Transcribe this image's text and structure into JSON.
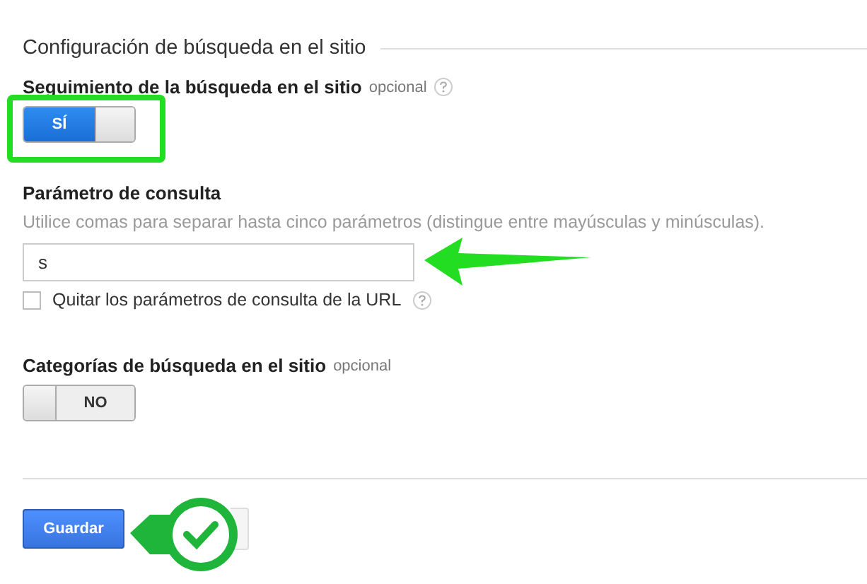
{
  "section_title": "Configuración de búsqueda en el sitio",
  "site_search_tracking": {
    "label": "Seguimiento de la búsqueda en el sitio",
    "optional": "opcional",
    "toggle": {
      "label": "SÍ",
      "on": true
    }
  },
  "query_parameter": {
    "label": "Parámetro de consulta",
    "hint": "Utilice comas para separar hasta cinco parámetros (distingue entre mayúsculas y minúsculas).",
    "value": "s",
    "checkbox": {
      "label": "Quitar los parámetros de consulta de la URL",
      "checked": false
    }
  },
  "site_search_categories": {
    "label": "Categorías de búsqueda en el sitio",
    "optional": "opcional",
    "toggle": {
      "label": "NO",
      "on": false
    }
  },
  "buttons": [
    "Guardar"
  ]
}
